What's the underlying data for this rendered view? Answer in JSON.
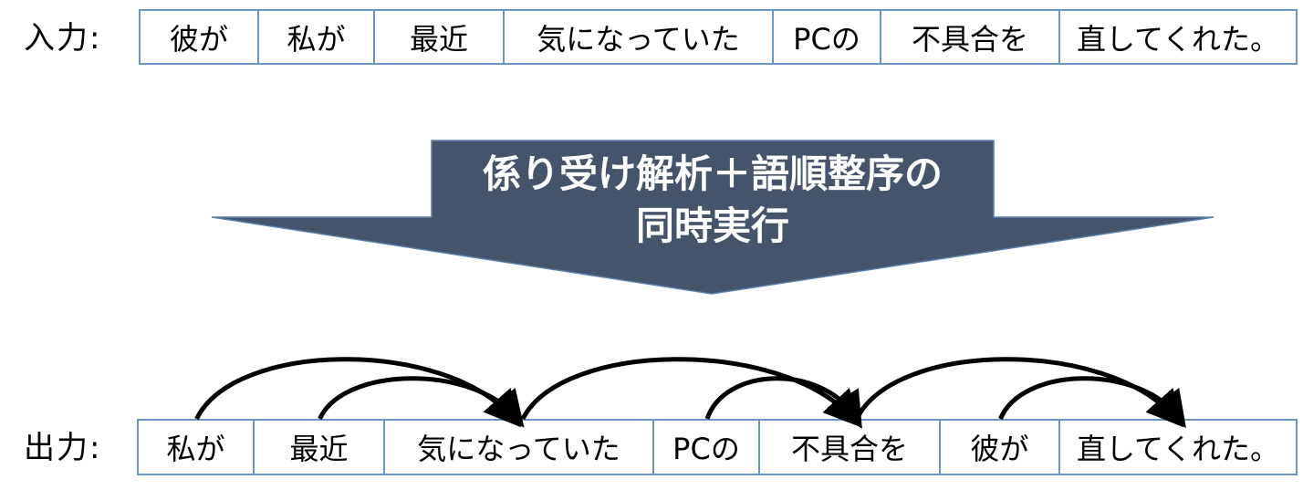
{
  "input": {
    "label": "入力:",
    "tokens": [
      "彼が",
      "私が",
      "最近",
      "気になっていた",
      "PCの",
      "不具合を",
      "直してくれた。"
    ]
  },
  "process": {
    "line1": "係り受け解析＋語順整序の",
    "line2": "同時実行",
    "fill_color": "#46546b"
  },
  "output": {
    "label": "出力:",
    "tokens": [
      "私が",
      "最近",
      "気になっていた",
      "PCの",
      "不具合を",
      "彼が",
      "直してくれた。"
    ]
  },
  "dependencies": [
    {
      "from": "私が",
      "to": "気になっていた",
      "from_index": 0,
      "to_index": 2
    },
    {
      "from": "最近",
      "to": "気になっていた",
      "from_index": 1,
      "to_index": 2
    },
    {
      "from": "気になっていた",
      "to": "不具合を",
      "from_index": 2,
      "to_index": 4
    },
    {
      "from": "PCの",
      "to": "不具合を",
      "from_index": 3,
      "to_index": 4
    },
    {
      "from": "不具合を",
      "to": "直してくれた。",
      "from_index": 4,
      "to_index": 6
    },
    {
      "from": "彼が",
      "to": "直してくれた。",
      "from_index": 5,
      "to_index": 6
    }
  ],
  "colors": {
    "box_border": "#6b95c3",
    "arc": "#000000",
    "arrow_fill": "#46546b",
    "arrow_text": "#ffffff"
  }
}
